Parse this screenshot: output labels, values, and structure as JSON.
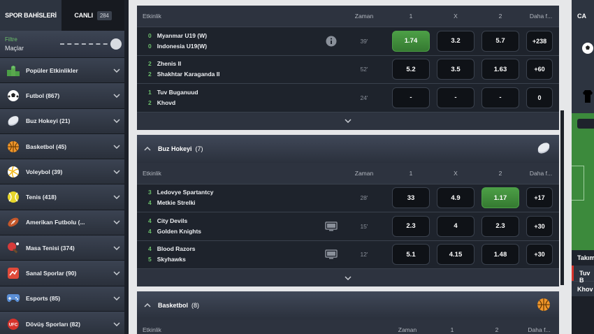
{
  "sidebar": {
    "tab_sports": "SPOR BAHİSLERİ",
    "tab_live": "CANLI",
    "live_count": "284",
    "filter_label": "Filtre",
    "filter_value": "Maçlar",
    "items": [
      {
        "label": "Popüler Etkinlikler",
        "icon": "popular-icon"
      },
      {
        "label": "Futbol (867)",
        "icon": "football-icon"
      },
      {
        "label": "Buz Hokeyi (21)",
        "icon": "ice-hockey-icon"
      },
      {
        "label": "Basketbol (45)",
        "icon": "basketball-icon"
      },
      {
        "label": "Voleybol (39)",
        "icon": "volleyball-icon"
      },
      {
        "label": "Tenis (418)",
        "icon": "tennis-icon"
      },
      {
        "label": "Amerikan Futbolu (...",
        "icon": "american-football-icon"
      },
      {
        "label": "Masa Tenisi (374)",
        "icon": "table-tennis-icon"
      },
      {
        "label": "Sanal Sporlar (90)",
        "icon": "virtual-sports-icon"
      },
      {
        "label": "Esports (85)",
        "icon": "esports-icon"
      },
      {
        "label": "Dövüş Sporları (82)",
        "icon": "fight-sports-icon"
      }
    ]
  },
  "columns": {
    "event": "Etkinlik",
    "time": "Zaman",
    "o1": "1",
    "ox": "X",
    "o2": "2",
    "more": "Daha f..."
  },
  "football": {
    "rows": [
      {
        "s1": "0",
        "s2": "0",
        "t1": "Myanmar U19 (W)",
        "t2": "Indonesia U19(W)",
        "time": "39'",
        "o1": "1.74",
        "ox": "3.2",
        "o2": "5.7",
        "more": "+238"
      },
      {
        "s1": "2",
        "s2": "2",
        "t1": "Zhenis II",
        "t2": "Shakhtar Karaganda II",
        "time": "52'",
        "o1": "5.2",
        "ox": "3.5",
        "o2": "1.63",
        "more": "+60"
      },
      {
        "s1": "1",
        "s2": "2",
        "t1": "Tuv Buganuud",
        "t2": "Khovd",
        "time": "24'",
        "o1": "-",
        "ox": "-",
        "o2": "-",
        "more": "0"
      }
    ]
  },
  "hockey": {
    "title": "Buz Hokeyi",
    "count": "(7)",
    "rows": [
      {
        "s1": "3",
        "s2": "4",
        "t1": "Ledovye Spartantcy",
        "t2": "Metkie Strelki",
        "time": "28'",
        "o1": "33",
        "ox": "4.9",
        "o2": "1.17",
        "more": "+17"
      },
      {
        "s1": "4",
        "s2": "4",
        "t1": "City Devils",
        "t2": "Golden Knights",
        "time": "15'",
        "o1": "2.3",
        "ox": "4",
        "o2": "2.3",
        "more": "+30"
      },
      {
        "s1": "4",
        "s2": "5",
        "t1": "Blood Razors",
        "t2": "Skyhawks",
        "time": "12'",
        "o1": "5.1",
        "ox": "4.15",
        "o2": "1.48",
        "more": "+30"
      }
    ]
  },
  "basketball": {
    "title": "Basketbol",
    "count": "(8)",
    "col_o2": "2",
    "col_o1": "1"
  },
  "right_panel": {
    "tab": "CA",
    "labels": [
      "Takım",
      "Tuv B",
      "Khov"
    ]
  },
  "colors": {
    "accent_green": "#4c9f46",
    "score_green": "#6bc06b",
    "bg_dark": "#1e232c"
  }
}
